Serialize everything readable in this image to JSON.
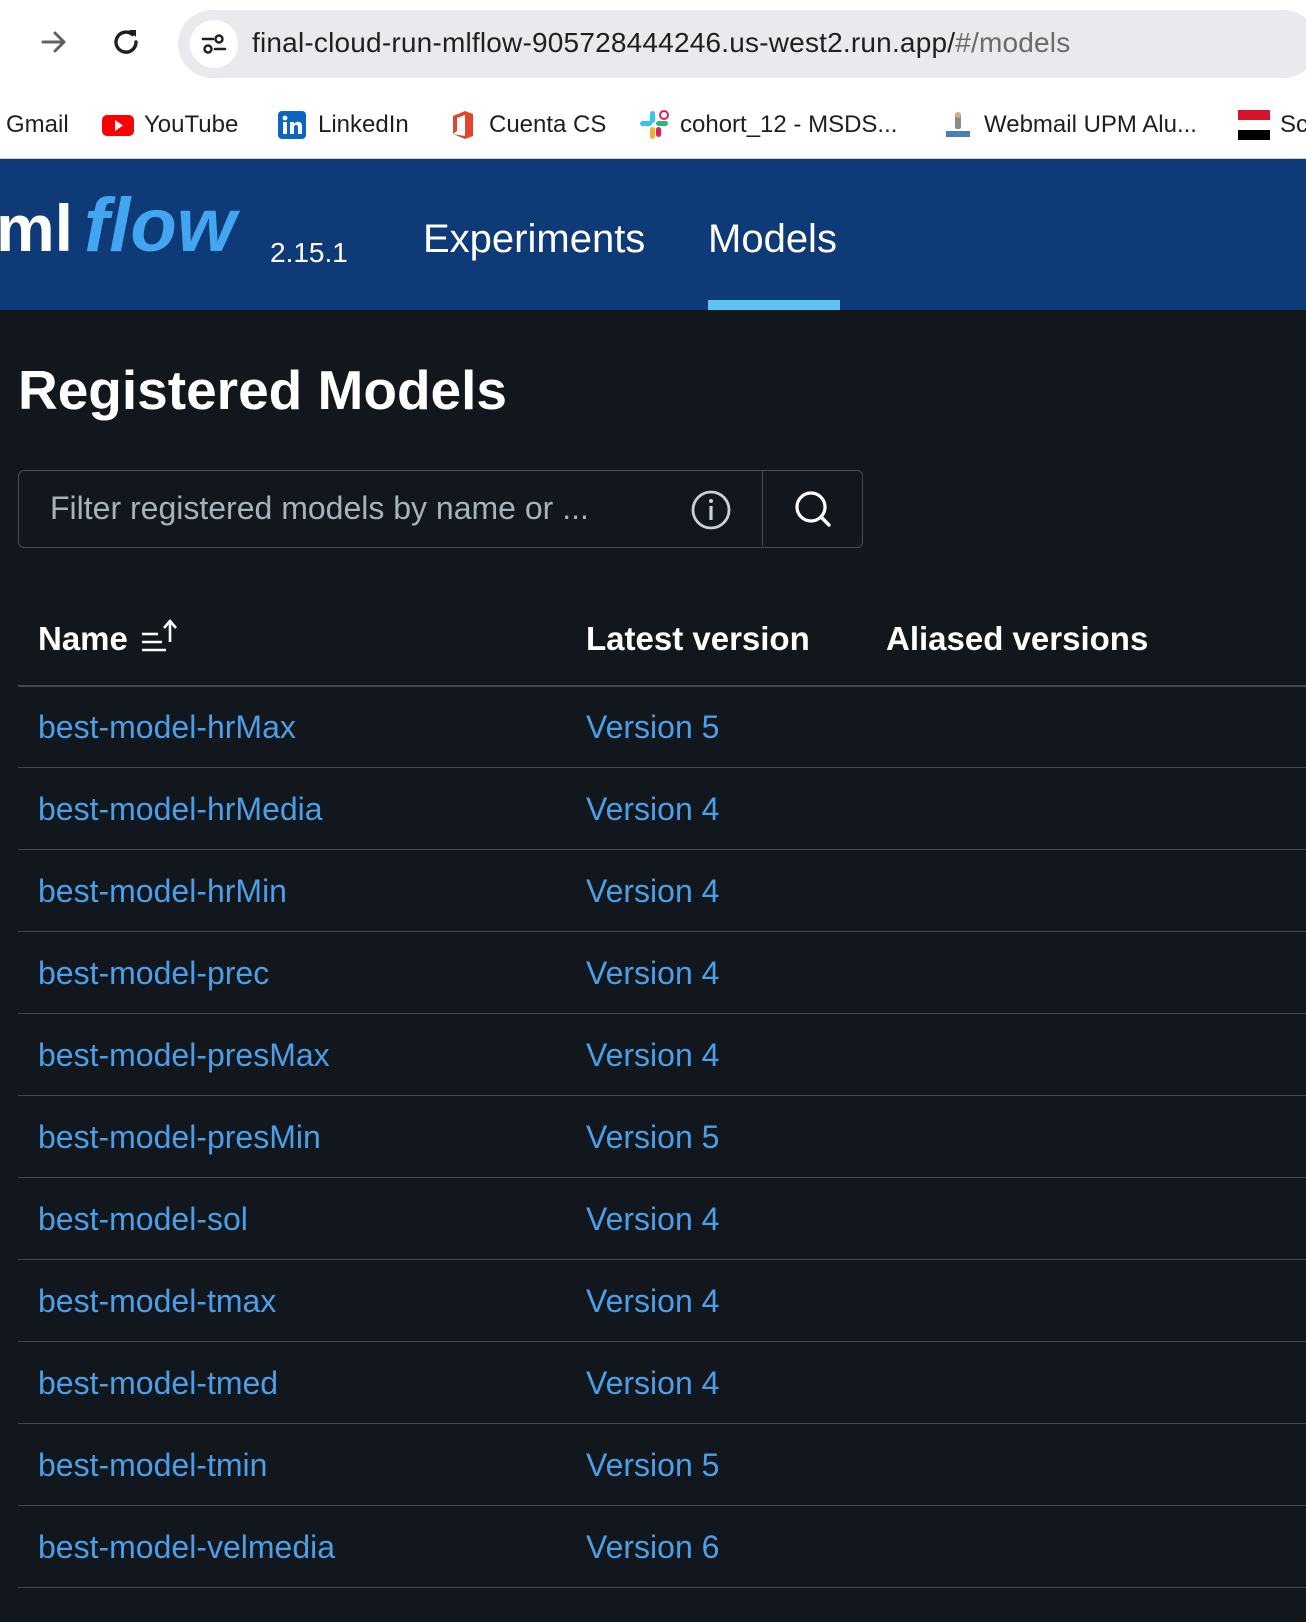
{
  "browser": {
    "url_main": "final-cloud-run-mlflow-905728444246.us-west2.run.app/",
    "url_hash": "#/models",
    "bookmarks": [
      {
        "label": "Gmail",
        "icon": "gmail-icon"
      },
      {
        "label": "YouTube",
        "icon": "youtube-icon"
      },
      {
        "label": "LinkedIn",
        "icon": "linkedin-icon"
      },
      {
        "label": "Cuenta CS",
        "icon": "office-icon"
      },
      {
        "label": "cohort_12 - MSDS...",
        "icon": "slack-icon"
      },
      {
        "label": "Webmail UPM Alu...",
        "icon": "upm-icon"
      },
      {
        "label": "Sc",
        "icon": "flag-icon"
      }
    ]
  },
  "app": {
    "logo_text": "mlflow",
    "version": "2.15.1",
    "nav": {
      "experiments": "Experiments",
      "models": "Models",
      "active": "models"
    },
    "colors": {
      "header_bg": "#0e3b78",
      "page_bg": "#11171c",
      "link": "#4d9ee6",
      "active_tab_underline": "#5ec3ef"
    }
  },
  "page": {
    "title": "Registered Models",
    "filter_placeholder": "Filter registered models by name or ...",
    "columns": {
      "name": "Name",
      "latest_version": "Latest version",
      "aliased_versions": "Aliased versions"
    },
    "models": [
      {
        "name": "best-model-hrMax",
        "latest_version": "Version 5"
      },
      {
        "name": "best-model-hrMedia",
        "latest_version": "Version 4"
      },
      {
        "name": "best-model-hrMin",
        "latest_version": "Version 4"
      },
      {
        "name": "best-model-prec",
        "latest_version": "Version 4"
      },
      {
        "name": "best-model-presMax",
        "latest_version": "Version 4"
      },
      {
        "name": "best-model-presMin",
        "latest_version": "Version 5"
      },
      {
        "name": "best-model-sol",
        "latest_version": "Version 4"
      },
      {
        "name": "best-model-tmax",
        "latest_version": "Version 4"
      },
      {
        "name": "best-model-tmed",
        "latest_version": "Version 4"
      },
      {
        "name": "best-model-tmin",
        "latest_version": "Version 5"
      },
      {
        "name": "best-model-velmedia",
        "latest_version": "Version 6"
      }
    ]
  }
}
